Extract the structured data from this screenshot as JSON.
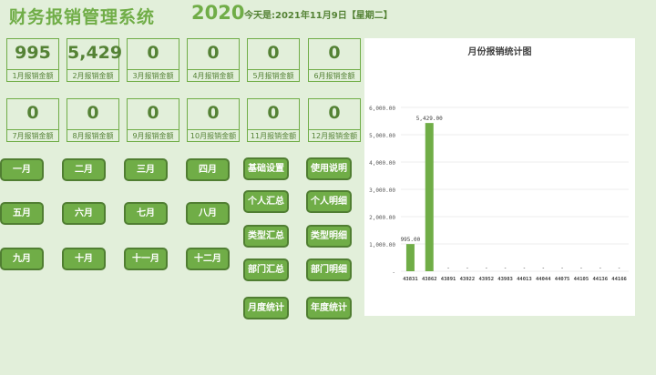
{
  "header": {
    "title": "财务报销管理系统",
    "year": "2020",
    "today": "今天是:2021年11月9日【星期二】"
  },
  "kpis": [
    {
      "value": "995",
      "label": "1月报销金额"
    },
    {
      "value": "5,429",
      "label": "2月报销金额"
    },
    {
      "value": "0",
      "label": "3月报销金额"
    },
    {
      "value": "0",
      "label": "4月报销金额"
    },
    {
      "value": "0",
      "label": "5月报销金额"
    },
    {
      "value": "0",
      "label": "6月报销金额"
    },
    {
      "value": "0",
      "label": "7月报销金额"
    },
    {
      "value": "0",
      "label": "8月报销金额"
    },
    {
      "value": "0",
      "label": "9月报销金额"
    },
    {
      "value": "0",
      "label": "10月报销金额"
    },
    {
      "value": "0",
      "label": "11月报销金额"
    },
    {
      "value": "0",
      "label": "12月报销金额"
    }
  ],
  "month_buttons": [
    "一月",
    "二月",
    "三月",
    "四月",
    "五月",
    "六月",
    "七月",
    "八月",
    "九月",
    "十月",
    "十一月",
    "十二月"
  ],
  "function_buttons": [
    [
      "基础设置",
      "使用说明"
    ],
    [
      "个人汇总",
      "个人明细"
    ],
    [
      "类型汇总",
      "类型明细"
    ],
    [
      "部门汇总",
      "部门明细"
    ],
    [
      "月度统计",
      "年度统计"
    ]
  ],
  "colors": {
    "background": "#e2efda",
    "accent": "#70ad47",
    "accent_dark": "#548235",
    "bar": "#70ad47"
  },
  "chart_data": {
    "type": "bar",
    "title": "月份报销统计图",
    "categories": [
      "43831",
      "43862",
      "43891",
      "43922",
      "43952",
      "43983",
      "44013",
      "44044",
      "44075",
      "44105",
      "44136",
      "44166"
    ],
    "values": [
      995,
      5429,
      0,
      0,
      0,
      0,
      0,
      0,
      0,
      0,
      0,
      0
    ],
    "data_labels": [
      "995.00",
      "5,429.00",
      "-",
      "-",
      "-",
      "-",
      "-",
      "-",
      "-",
      "-",
      "-",
      "-"
    ],
    "ylim": [
      0,
      6000
    ],
    "yticks": [
      0,
      1000,
      2000,
      3000,
      4000,
      5000,
      6000
    ],
    "ytick_labels": [
      "-",
      "1,000.00",
      "2,000.00",
      "3,000.00",
      "4,000.00",
      "5,000.00",
      "6,000.00"
    ],
    "grid": true,
    "legend": false
  }
}
